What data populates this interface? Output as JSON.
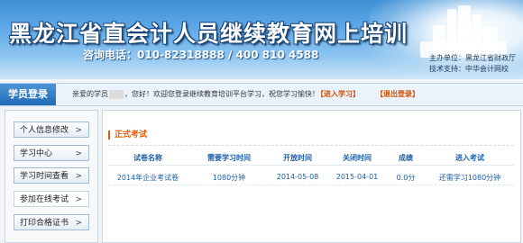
{
  "header": {
    "title": "黑龙江省直会计人员继续教育网上培训",
    "hotline": "咨询电话：010-82318888 / 400 810 4588",
    "organizer": "主办单位：黑龙江省财政厅",
    "tech_support": "技术支持：中华会计网校"
  },
  "navbar": {
    "login_tab": "学员登录",
    "welcome_prefix": "亲爱的学员",
    "welcome_suffix": "，您好！欢迎您登录继续教育培训平台学习，祝您学习愉快！",
    "enter_study": "【进入学习】",
    "logout": "【退出登录】"
  },
  "sidebar": {
    "items": [
      {
        "label": "个人信息修改"
      },
      {
        "label": "学习中心"
      },
      {
        "label": "学习时间查看"
      },
      {
        "label": "参加在线考试"
      },
      {
        "label": "打印合格证书"
      }
    ]
  },
  "main": {
    "section_title": "正式考试",
    "columns": [
      "试卷名称",
      "需要学习时间",
      "开放时间",
      "关闭时间",
      "成绩",
      "进入考试"
    ],
    "rows": [
      [
        "2014年企业考试卷",
        "1080分钟",
        "2014-05-08",
        "2015-04-01",
        "0.0分",
        "还需学习1080分钟"
      ]
    ]
  },
  "colors": {
    "accent_orange": "#e05a00",
    "link_blue": "#1b5ea8",
    "banner_blue": "#3f8fd6"
  }
}
